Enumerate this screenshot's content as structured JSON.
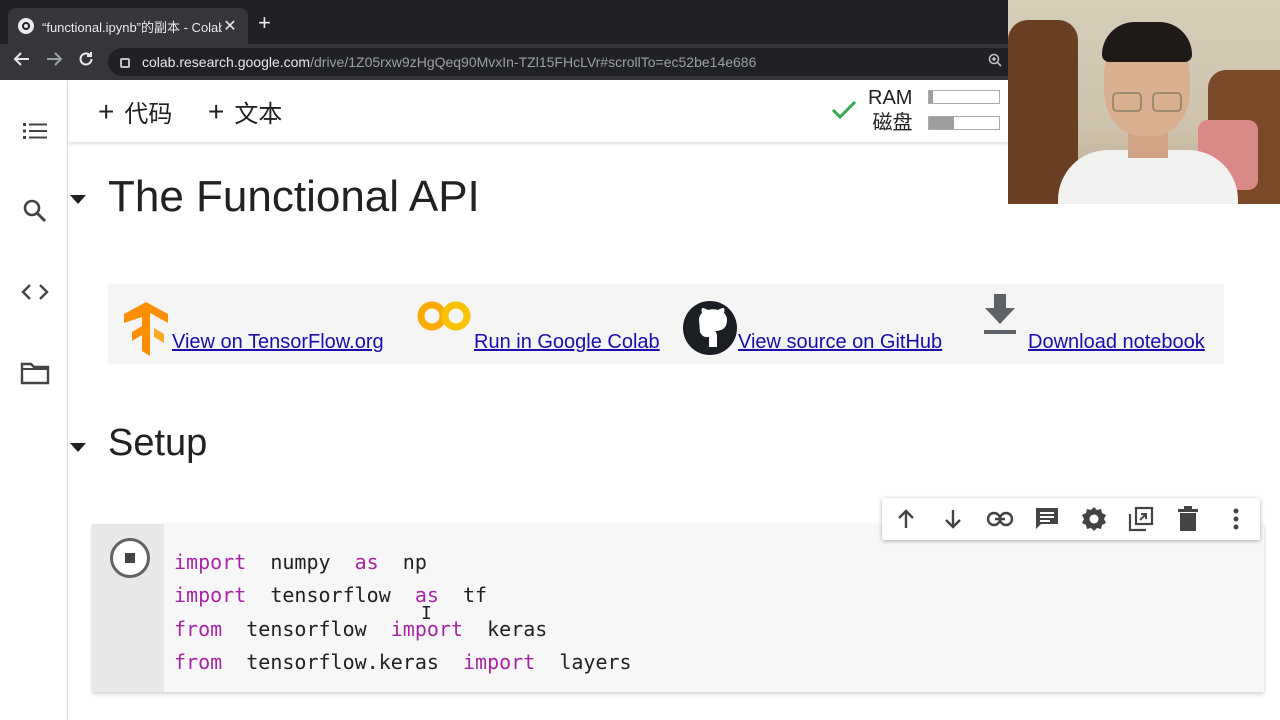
{
  "browser": {
    "tab_title": "“functional.ipynb”的副本 - Colab",
    "url_host": "colab.research.google.com",
    "url_path": "/drive/1Z05rxw9zHgQeq90MvxIn-TZl15FHcLVr#scrollTo=ec52be14e686"
  },
  "toolbar": {
    "add_code": "代码",
    "add_text": "文本",
    "ram_label": "RAM",
    "disk_label": "磁盘",
    "ram_usage": 0.06,
    "disk_usage": 0.35
  },
  "notebook": {
    "heading1": "The Functional API",
    "links": [
      {
        "label": "View on TensorFlow.org",
        "icon": "tensorflow-logo"
      },
      {
        "label": "Run in Google Colab",
        "icon": "colab-logo"
      },
      {
        "label": "View source on GitHub",
        "icon": "github-logo"
      },
      {
        "label": "Download notebook",
        "icon": "download-icon"
      }
    ],
    "heading2": "Setup",
    "code_lines": [
      [
        {
          "t": "import",
          "kw": true
        },
        {
          "t": "  numpy  ",
          "kw": false
        },
        {
          "t": "as",
          "kw": true
        },
        {
          "t": "  np",
          "kw": false
        }
      ],
      [
        {
          "t": "import",
          "kw": true
        },
        {
          "t": "  tensorflow  ",
          "kw": false
        },
        {
          "t": "as",
          "kw": true
        },
        {
          "t": "  tf",
          "kw": false
        }
      ],
      [
        {
          "t": "from",
          "kw": true
        },
        {
          "t": "  tensorflow  ",
          "kw": false
        },
        {
          "t": "import",
          "kw": true
        },
        {
          "t": "  keras",
          "kw": false
        }
      ],
      [
        {
          "t": "from",
          "kw": true
        },
        {
          "t": "  tensorflow.keras  ",
          "kw": false
        },
        {
          "t": "import",
          "kw": true
        },
        {
          "t": "  layers",
          "kw": false
        }
      ]
    ]
  },
  "cell_toolbar": [
    "arrow-up-icon",
    "arrow-down-icon",
    "link-icon",
    "comment-icon",
    "gear-icon",
    "mirror-cell-icon",
    "trash-icon",
    "more-vert-icon"
  ],
  "colors": {
    "keyword": "#a626a4",
    "link": "#1a0dab",
    "check": "#34a853"
  }
}
